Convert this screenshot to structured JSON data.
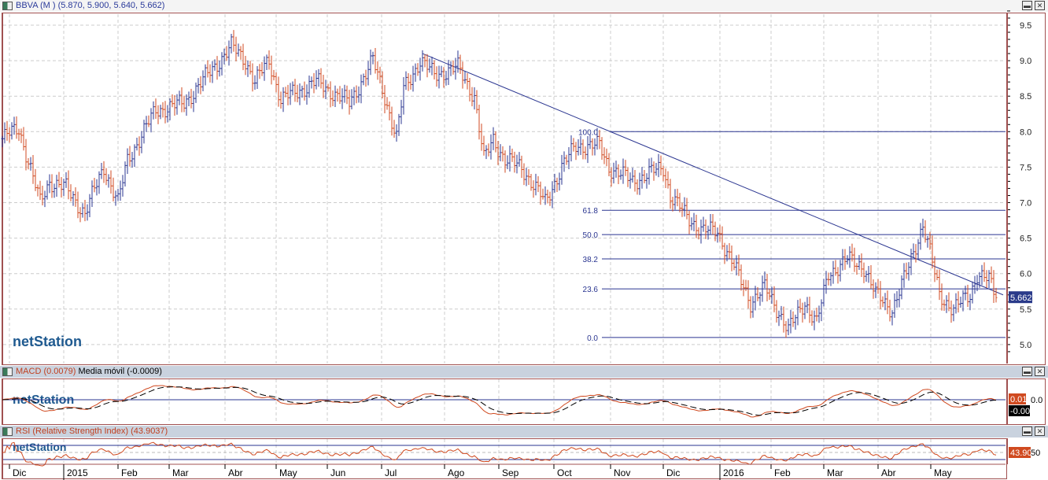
{
  "main": {
    "title": "BBVA (M ) (5.870, 5.900, 5.640, 5.662)",
    "last_label": "5.662",
    "y_ticks": [
      "9.5",
      "9.0",
      "8.5",
      "8.0",
      "7.5",
      "7.0",
      "6.5",
      "6.0",
      "5.5",
      "5.0"
    ],
    "fib_labels": [
      "100.0",
      "61.8",
      "50.0",
      "38.2",
      "23.6",
      "0.0"
    ],
    "logo": "netStation"
  },
  "macd": {
    "title": "MACD (0.0079)",
    "signal_title": "Media móvil (-0.0009)",
    "value_label": "0.01",
    "signal_label": "-0.00",
    "tick": "0.0"
  },
  "rsi": {
    "title": "RSI (Relative Strength Index) (43.9037)",
    "value_label": "43.90",
    "tick": "50"
  },
  "x_labels": [
    "Dic",
    "2015",
    "Feb",
    "Mar",
    "Abr",
    "May",
    "Jun",
    "Jul",
    "Ago",
    "Sep",
    "Oct",
    "Nov",
    "Dic",
    "2016",
    "Feb",
    "Mar",
    "Abr",
    "May"
  ],
  "chart_data": {
    "type": "ohlc",
    "title": "BBVA (M)",
    "ohlc_last": {
      "open": 5.87,
      "high": 5.9,
      "low": 5.64,
      "close": 5.662
    },
    "ylim": [
      4.8,
      9.7
    ],
    "close_keypoints": [
      [
        0,
        7.9
      ],
      [
        7,
        8.05
      ],
      [
        16,
        7.0
      ],
      [
        20,
        7.3
      ],
      [
        27,
        7.2
      ],
      [
        35,
        6.85
      ],
      [
        43,
        7.5
      ],
      [
        49,
        7.0
      ],
      [
        53,
        7.6
      ],
      [
        65,
        8.3
      ],
      [
        77,
        8.4
      ],
      [
        87,
        8.8
      ],
      [
        97,
        9.2
      ],
      [
        103,
        9.0
      ],
      [
        107,
        8.7
      ],
      [
        113,
        9.0
      ],
      [
        118,
        8.45
      ],
      [
        127,
        8.6
      ],
      [
        133,
        8.7
      ],
      [
        140,
        8.55
      ],
      [
        147,
        8.4
      ],
      [
        157,
        9.0
      ],
      [
        162,
        8.5
      ],
      [
        167,
        7.9
      ],
      [
        170,
        8.6
      ],
      [
        177,
        9.0
      ],
      [
        183,
        8.8
      ],
      [
        193,
        8.9
      ],
      [
        200,
        8.5
      ],
      [
        204,
        7.6
      ],
      [
        208,
        7.9
      ],
      [
        213,
        7.6
      ],
      [
        220,
        7.5
      ],
      [
        230,
        7.0
      ],
      [
        237,
        7.5
      ],
      [
        243,
        7.8
      ],
      [
        253,
        7.8
      ],
      [
        257,
        7.5
      ],
      [
        267,
        7.3
      ],
      [
        280,
        7.5
      ],
      [
        283,
        7.1
      ],
      [
        290,
        6.8
      ],
      [
        297,
        6.6
      ],
      [
        303,
        6.6
      ],
      [
        310,
        6.1
      ],
      [
        317,
        5.6
      ],
      [
        323,
        5.8
      ],
      [
        330,
        5.4
      ],
      [
        333,
        5.2
      ],
      [
        340,
        5.6
      ],
      [
        345,
        5.3
      ],
      [
        350,
        6.0
      ],
      [
        358,
        6.2
      ],
      [
        365,
        6.1
      ],
      [
        370,
        5.7
      ],
      [
        377,
        5.5
      ],
      [
        383,
        6.0
      ],
      [
        390,
        6.7
      ],
      [
        393,
        6.3
      ],
      [
        397,
        5.7
      ],
      [
        403,
        5.5
      ],
      [
        410,
        5.7
      ],
      [
        413,
        6.0
      ],
      [
        418,
        5.9
      ],
      [
        421,
        5.662
      ]
    ],
    "fibonacci": {
      "high": 8.0,
      "low": 5.1,
      "levels": [
        100.0,
        61.8,
        50.0,
        38.2,
        23.6,
        0.0
      ]
    },
    "trendline": [
      [
        178,
        9.1
      ],
      [
        424,
        5.7
      ]
    ]
  }
}
